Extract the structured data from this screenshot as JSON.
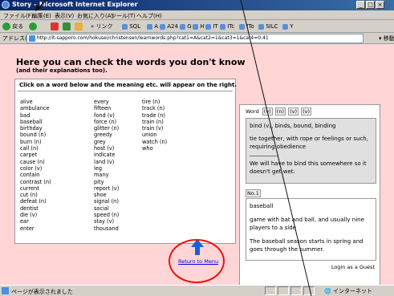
{
  "window": {
    "title": "Story – Microsoft Internet Explorer"
  },
  "menu": [
    "ファイル(F)",
    "編集(E)",
    "表示(V)",
    "お気に入り(A)",
    "ツール(T)",
    "ヘルプ(H)"
  ],
  "toolbar": {
    "back": "戻る",
    "links_label": "» リンク",
    "links": [
      "SQL",
      "A",
      "A24",
      "G",
      "H",
      "IT",
      "ITc",
      "ITo",
      "SILC",
      "Y"
    ]
  },
  "address": {
    "label": "アドレス(D)",
    "url": "http://it-sapporo.com/hokusei/christensen/learnwords.php?cat1=A&cat2=1&cat3=1&cat4=0:41",
    "go": "移動"
  },
  "page": {
    "heading": "Here you can check the words you don't know",
    "subheading": "(and their explanations too).",
    "instructions": "Click on a word below and the meaning etc. will appear on the right.",
    "columns": [
      [
        "alive",
        "ambulance",
        "bad",
        "baseball",
        "birthday",
        "bound (n)",
        "burn (n)",
        "call (n)",
        "carpet",
        "cause (n)",
        "color (v)",
        "contain",
        "contrast (n)",
        "current",
        "cut (n)",
        "defeat (n)",
        "dentist",
        "die (v)",
        "ear",
        "enter"
      ],
      [
        "every",
        "fifteen",
        "fond (v)",
        "force (n)",
        "glitter (n)",
        "greedy",
        "grey",
        "host (v)",
        "indicate",
        "land (v)",
        "leg",
        "many",
        "pity",
        "report (v)",
        "shoe",
        "signal (n)",
        "social",
        "speed (n)",
        "stay (v)",
        "thousand"
      ],
      [
        "tire (n)",
        "track (n)",
        "trade (n)",
        "train (n)",
        "train (v)",
        "union",
        "watch (n)",
        "who"
      ]
    ],
    "word_tabs_label": "Word",
    "word_tabs": [
      "(v)",
      "(n)",
      "(v)",
      "(v)"
    ],
    "definition": {
      "forms": "bind (v), binds, bound, binding",
      "meaning": "tie together, with rope or feelings or such, requiring obedience",
      "example": "We will have to bind this somewhere so it doesn't get wet."
    },
    "number_tag": "No.1",
    "example": {
      "word": "baseball",
      "meaning": "game with bat and ball, and usually nine players to a side",
      "sentence": "The baseball season starts in spring and goes through the summer."
    },
    "login_status": "Login as a Guest",
    "return_link": "Return to Menu"
  },
  "status": {
    "text": "ページが表示されました",
    "zone": "インターネット"
  },
  "colors": {
    "page_bg": "#ffd5d5",
    "annotation": "#e11111",
    "link": "#0000ee",
    "arrow": "#1c5fd6"
  }
}
